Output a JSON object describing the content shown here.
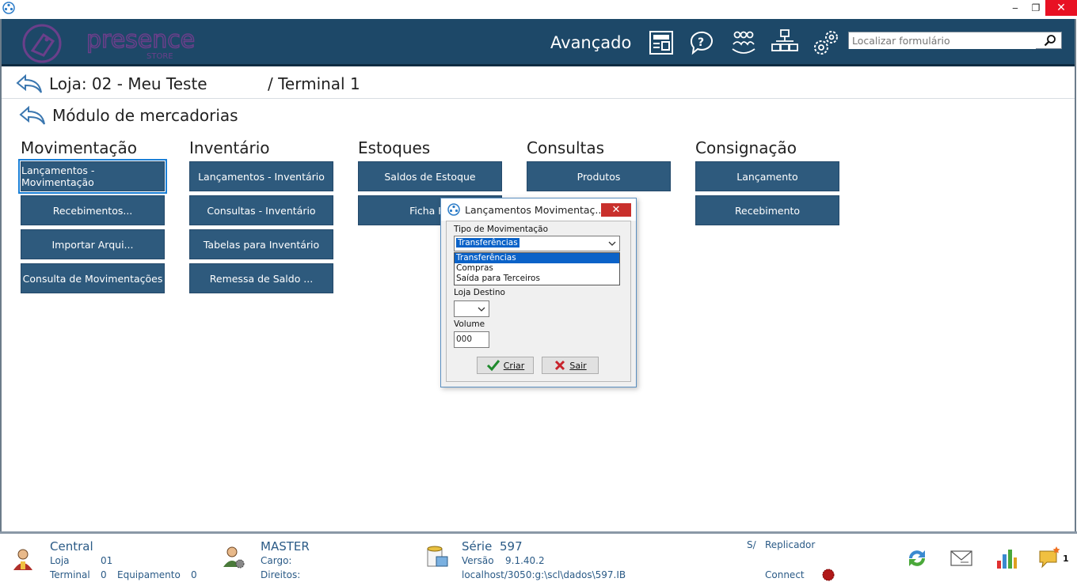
{
  "window": {
    "minimize": "‒",
    "maximize": "❐",
    "close": "✕"
  },
  "header": {
    "logo_text": "presence",
    "logo_sub": "STORE",
    "advanced_label": "Avançado",
    "search_placeholder": "Localizar formulário",
    "icons": [
      "news-icon",
      "help-icon",
      "users-icon",
      "network-icon",
      "gear-icon"
    ]
  },
  "breadcrumb": {
    "store": "Loja: 02 - Meu Teste",
    "terminal": "/ Terminal 1",
    "module": "Módulo de mercadorias"
  },
  "columns": [
    {
      "title": "Movimentação",
      "items": [
        "Lançamentos - Movimentação",
        "Recebimentos...",
        "Importar Arqui...",
        "Consulta de Movimentações"
      ]
    },
    {
      "title": "Inventário",
      "items": [
        "Lançamentos - Inventário",
        "Consultas - Inventário",
        "Tabelas para Inventário",
        "Remessa de Saldo ..."
      ]
    },
    {
      "title": "Estoques",
      "items": [
        "Saldos de Estoque",
        "Ficha Ka"
      ]
    },
    {
      "title": "Consultas",
      "items": [
        "Produtos"
      ]
    },
    {
      "title": "Consignação",
      "items": [
        "Lançamento",
        "Recebimento"
      ]
    }
  ],
  "dialog": {
    "title": "Lançamentos Movimentaç...",
    "close": "✕",
    "tipo_label": "Tipo de Movimentação",
    "tipo_value": "Transferências",
    "options": [
      "Transferências",
      "Compras",
      "Saída para Terceiros"
    ],
    "loja_label": "Loja Destino",
    "volume_label": "Volume",
    "volume_value": "000",
    "create_label": "Criar",
    "exit_label": "Sair"
  },
  "status": {
    "central": "Central",
    "loja_label": "Loja",
    "loja_value": "01",
    "terminal_label": "Terminal",
    "terminal_value": "0",
    "equip_label": "Equipamento",
    "equip_value": "0",
    "user": "MASTER",
    "cargo": "Cargo:",
    "direitos": "Direitos:",
    "serie_label": "Série",
    "serie_value": "597",
    "versao_label": "Versão",
    "versao_value": "9.1.40.2",
    "db_path": "localhost/3050:g:\\scl\\dados\\597.IB",
    "sa_label": "S/",
    "replicador": "Replicador",
    "connect": "Connect",
    "notify_count": "1"
  },
  "colors": {
    "header_bg": "#1d4868",
    "button_bg": "#2e5a7d",
    "status_text": "#2a5a86",
    "close_red": "#e81123"
  }
}
